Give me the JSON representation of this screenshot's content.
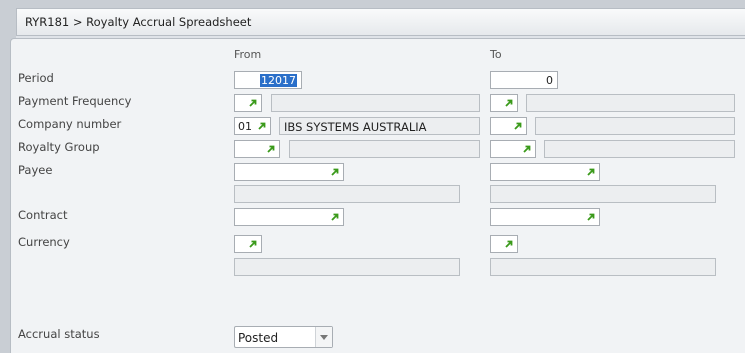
{
  "breadcrumb": "RYR181 > Royalty Accrual Spreadsheet",
  "columns": {
    "from": "From",
    "to": "To"
  },
  "labels": {
    "period": "Period",
    "payment_frequency": "Payment Frequency",
    "company_number": "Company number",
    "royalty_group": "Royalty Group",
    "payee": "Payee",
    "contract": "Contract",
    "currency": "Currency",
    "accrual_status": "Accrual status"
  },
  "fields": {
    "period_from": "12017",
    "period_to": "0",
    "company_from": "01",
    "company_from_desc": "IBS SYSTEMS AUSTRALIA",
    "accrual_status": "Posted"
  },
  "icons": {
    "lookup": "lookup-arrow-icon",
    "dropdown": "chevron-down-icon"
  },
  "colors": {
    "lookup_arrow": "#3a9a1a",
    "selection": "#2a6fc9"
  }
}
